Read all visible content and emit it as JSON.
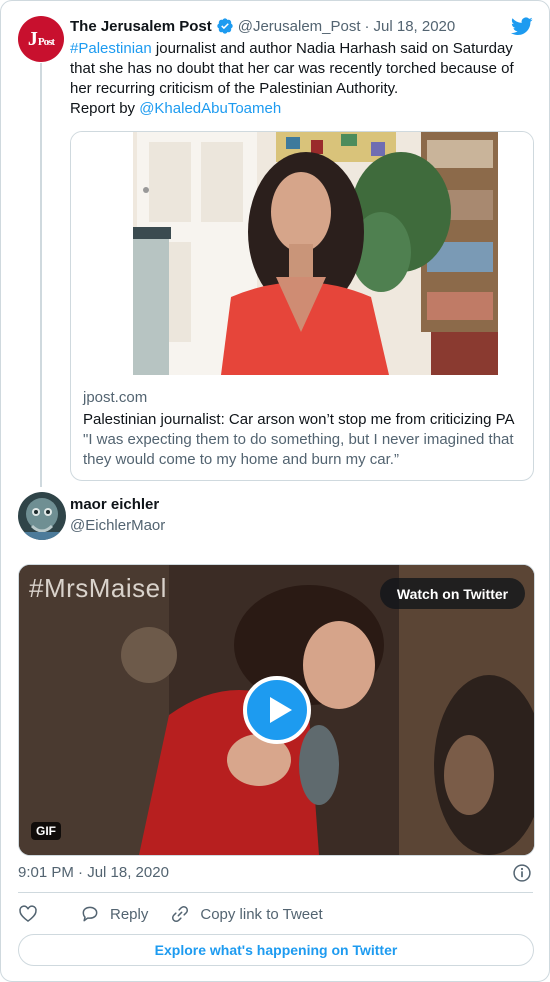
{
  "tweet": {
    "author_name": "The Jerusalem Post",
    "author_handle": "@Jerusalem_Post",
    "separator": "·",
    "date": "Jul 18, 2020",
    "avatar_text": "J",
    "avatar_text_small": "Post",
    "hashtag": "#Palestinian",
    "text_line1_rest": " journalist and author Nadia Harhash said on Saturday that she has no doubt that her car was recently torched because of her recurring criticism of the Palestinian Authority.",
    "report_prefix": "Report by ",
    "report_mention": "@KhaledAbuToameh",
    "card": {
      "domain": "jpost.com",
      "title": "Palestinian journalist: Car arson won’t stop me from criticizing PA",
      "description": "\"I was expecting them to do something, but I never imagined that they would come to my home and burn my car.”"
    }
  },
  "reply": {
    "author_name": "maor eichler",
    "author_handle": "@EichlerMaor",
    "media": {
      "overlay_title": "#MrsMaisel",
      "watch_label": "Watch on Twitter",
      "badge": "GIF"
    },
    "timestamp": "9:01 PM · Jul 18, 2020"
  },
  "actions": {
    "like_label": "",
    "reply_label": "Reply",
    "copy_label": "Copy link to Tweet"
  },
  "explore_label": "Explore what's happening on Twitter",
  "colors": {
    "accent": "#1d9bf0",
    "text": "#0f1419",
    "muted": "#536471",
    "border": "#cfd9de",
    "jpost_red": "#c8102e"
  },
  "icons": [
    "verified-badge-icon",
    "twitter-bird-icon",
    "play-icon",
    "info-icon",
    "heart-icon",
    "reply-bubble-icon",
    "link-icon"
  ]
}
